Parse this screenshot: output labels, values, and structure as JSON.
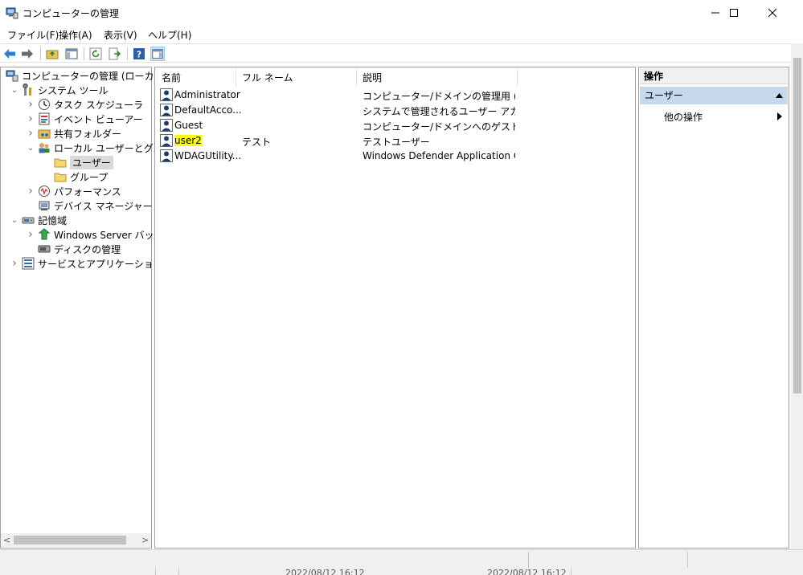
{
  "window": {
    "title": "コンピューターの管理"
  },
  "menu": [
    "ファイル(F)",
    "操作(A)",
    "表示(V)",
    "ヘルプ(H)"
  ],
  "tree": [
    {
      "label": "コンピューターの管理 (ローカル)",
      "level": 0,
      "expander": "",
      "icon": "computer-icon"
    },
    {
      "label": "システム ツール",
      "level": 1,
      "expander": "open",
      "icon": "tools-icon"
    },
    {
      "label": "タスク スケジューラ",
      "level": 2,
      "expander": "closed",
      "icon": "clock-icon"
    },
    {
      "label": "イベント ビューアー",
      "level": 2,
      "expander": "closed",
      "icon": "event-viewer-icon"
    },
    {
      "label": "共有フォルダー",
      "level": 2,
      "expander": "closed",
      "icon": "shared-folder-icon"
    },
    {
      "label": "ローカル ユーザーとグループ",
      "level": 2,
      "expander": "open",
      "icon": "users-groups-icon"
    },
    {
      "label": "ユーザー",
      "level": 3,
      "expander": "",
      "icon": "folder-icon",
      "selected": true
    },
    {
      "label": "グループ",
      "level": 3,
      "expander": "",
      "icon": "folder-icon"
    },
    {
      "label": "パフォーマンス",
      "level": 2,
      "expander": "closed",
      "icon": "performance-icon"
    },
    {
      "label": "デバイス マネージャー",
      "level": 2,
      "expander": "",
      "icon": "device-manager-icon"
    },
    {
      "label": "記憶域",
      "level": 1,
      "expander": "open",
      "icon": "storage-icon"
    },
    {
      "label": "Windows Server バックア",
      "level": 2,
      "expander": "closed",
      "icon": "backup-icon"
    },
    {
      "label": "ディスクの管理",
      "level": 2,
      "expander": "",
      "icon": "disk-icon"
    },
    {
      "label": "サービスとアプリケーション",
      "level": 1,
      "expander": "closed",
      "icon": "services-icon"
    }
  ],
  "columns": [
    "名前",
    "フル ネーム",
    "説明"
  ],
  "users": [
    {
      "name": "Administrator",
      "full_name": "",
      "description": "コンピューター/ドメインの管理用 (ビルト...",
      "highlight": false
    },
    {
      "name": "DefaultAcco...",
      "full_name": "",
      "description": "システムで管理されるユーザー アカウン...",
      "highlight": false
    },
    {
      "name": "Guest",
      "full_name": "",
      "description": "コンピューター/ドメインへのゲスト アクセ...",
      "highlight": false
    },
    {
      "name": "user2",
      "full_name": "テスト",
      "description": "テストユーザー",
      "highlight": true
    },
    {
      "name": "WDAGUtility...",
      "full_name": "",
      "description": "Windows Defender Application G...",
      "highlight": false
    }
  ],
  "actions": {
    "title": "操作",
    "section": "ユーザー",
    "more": "他の操作"
  },
  "status_fragments": [
    "2022/08/12 16:12",
    "2022/08/12 16:12"
  ],
  "colors": {
    "selection": "#d9d9d9",
    "highlight": "#ffff00",
    "action_section": "#c6d8ee"
  }
}
